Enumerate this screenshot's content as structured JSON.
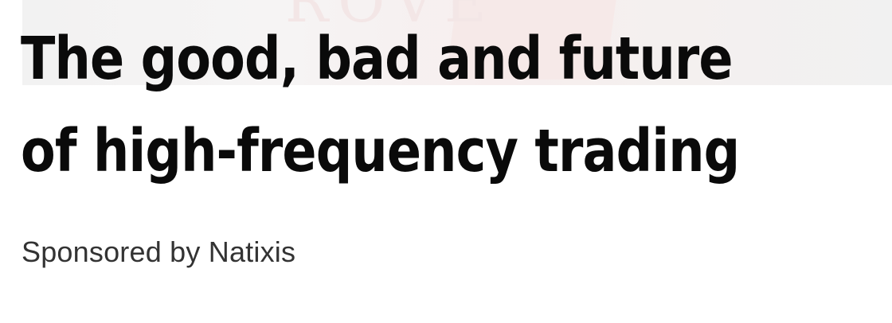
{
  "article": {
    "headline": "The good, bad and future of high-frequency trading",
    "sponsor_text": "Sponsored by Natixis"
  },
  "colors": {
    "headline": "#0a0a0a",
    "sponsor": "#333333",
    "hero_strip": "#f4f0ef"
  }
}
